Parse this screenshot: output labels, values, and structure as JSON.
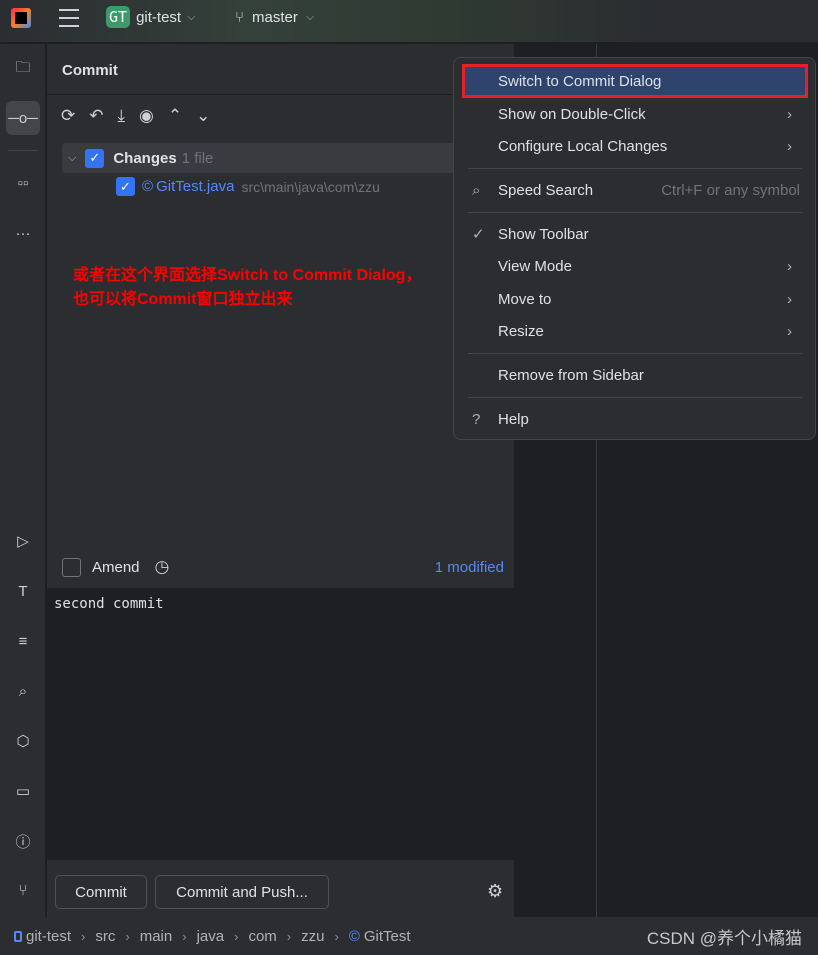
{
  "topbar": {
    "project_badge": "GT",
    "project": "git-test",
    "branch": "master"
  },
  "panel": {
    "title": "Commit",
    "changes_label": "Changes",
    "changes_count": "1 file",
    "file_name": "GitTest.java",
    "file_path": "src\\main\\java\\com\\zzu",
    "amend_label": "Amend",
    "modified": "1 modified",
    "commit_message": "second commit",
    "commit_button": "Commit",
    "commit_push_button": "Commit and Push..."
  },
  "annotation": {
    "line1": "或者在这个界面选择Switch to Commit Dialog，",
    "line2": "也可以将Commit窗口独立出来",
    "color": "#ff0000"
  },
  "menu": {
    "items": [
      {
        "label": "Switch to Commit Dialog"
      },
      {
        "label": "Show on Double-Click"
      },
      {
        "label": "Configure Local Changes"
      },
      {
        "label": "Speed Search",
        "shortcut": "Ctrl+F or any symbol"
      },
      {
        "label": "Show Toolbar"
      },
      {
        "label": "View Mode"
      },
      {
        "label": "Move to"
      },
      {
        "label": "Resize"
      },
      {
        "label": "Remove from Sidebar"
      },
      {
        "label": "Help"
      }
    ]
  },
  "breadcrumb": [
    "git-test",
    "src",
    "main",
    "java",
    "com",
    "zzu",
    "GitTest"
  ],
  "watermark": "CSDN @养个小橘猫",
  "colors": {
    "accent": "#3574f0",
    "highlight": "#2e436e",
    "link": "#548af7"
  }
}
